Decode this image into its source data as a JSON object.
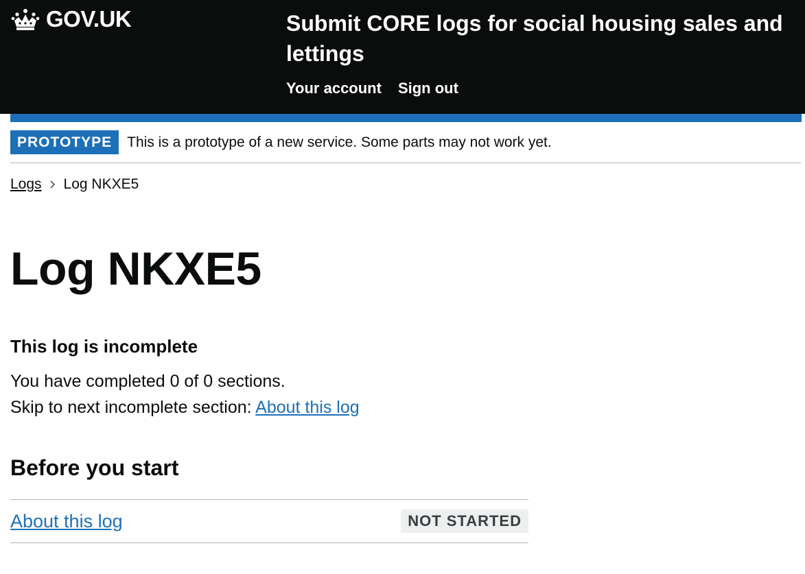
{
  "header": {
    "logo_text": "GOV.UK",
    "service_name": "Submit CORE logs for social housing sales and lettings",
    "nav": [
      {
        "label": "Your account"
      },
      {
        "label": "Sign out"
      }
    ]
  },
  "phase_banner": {
    "tag": "PROTOTYPE",
    "text": "This is a prototype of a new service. Some parts may not work yet."
  },
  "breadcrumbs": [
    {
      "label": "Logs"
    },
    {
      "label": "Log NKXE5"
    }
  ],
  "page_title": "Log NKXE5",
  "status": {
    "heading": "This log is incomplete",
    "completed_text": "You have completed 0 of 0 sections.",
    "skip_text": "Skip to next incomplete section: ",
    "skip_link": "About this log"
  },
  "sections": [
    {
      "heading": "Before you start",
      "tasks": [
        {
          "label": "About this log",
          "status": "NOT STARTED"
        }
      ]
    }
  ],
  "colors": {
    "header_bg": "#0b0c0c",
    "brand_blue": "#1d70b8",
    "link": "#1d70b8",
    "tag_grey_bg": "#eeefef"
  }
}
